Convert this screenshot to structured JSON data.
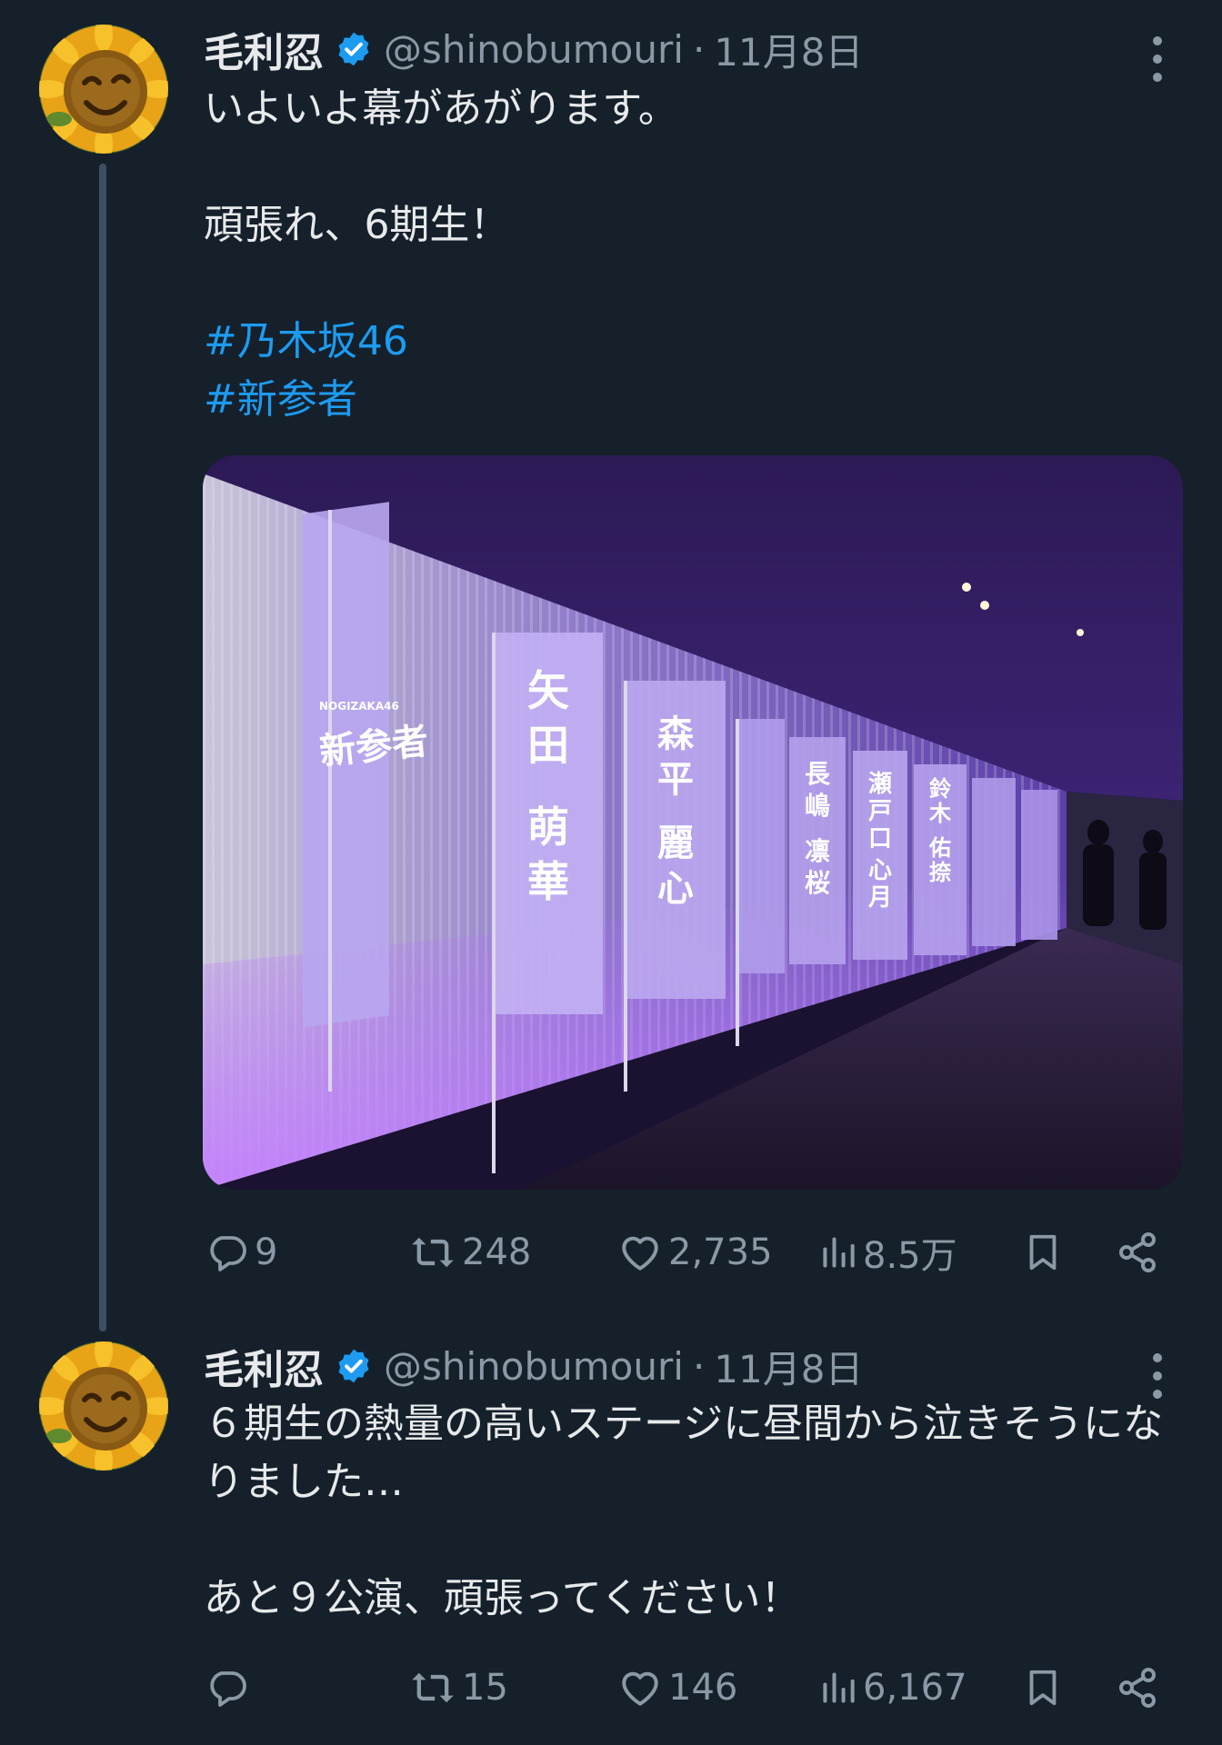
{
  "tweets": [
    {
      "author_name": "毛利忍",
      "handle": "@shinobumouri",
      "separator": "·",
      "date": "11月8日",
      "paragraphs": [
        "いよいよ幕があがります。",
        "頑張れ、6期生！"
      ],
      "hashtags": [
        "#乃木坂46",
        "#新参者"
      ],
      "media": {
        "banner_names": [
          "矢田　萌華",
          "森平　麗心",
          "長嶋　凛桜",
          "瀬戸口　心月",
          "鈴木　佑捺"
        ],
        "logo_text": "新参者",
        "small_text": "NOGIZAKA46"
      },
      "stats": {
        "replies": "9",
        "retweets": "248",
        "likes": "2,735",
        "views": "8.5万"
      }
    },
    {
      "author_name": "毛利忍",
      "handle": "@shinobumouri",
      "separator": "·",
      "date": "11月8日",
      "paragraphs": [
        "６期生の熱量の高いステージに昼間から泣きそうになりました…",
        "あと９公演、頑張ってください！"
      ],
      "stats": {
        "replies": "",
        "retweets": "15",
        "likes": "146",
        "views": "6,167"
      }
    }
  ],
  "colors": {
    "background": "#15202b",
    "text": "#e7e9ea",
    "secondary_text": "#8b98a5",
    "link": "#1d9bf0",
    "verified": "#1d9bf0",
    "thread_line": "#3d4f60"
  },
  "icons": {
    "reply": "reply-icon",
    "retweet": "retweet-icon",
    "like": "heart-icon",
    "views": "views-icon",
    "bookmark": "bookmark-icon",
    "share": "share-icon",
    "more": "more-vertical-icon",
    "verified": "verified-badge-icon"
  }
}
